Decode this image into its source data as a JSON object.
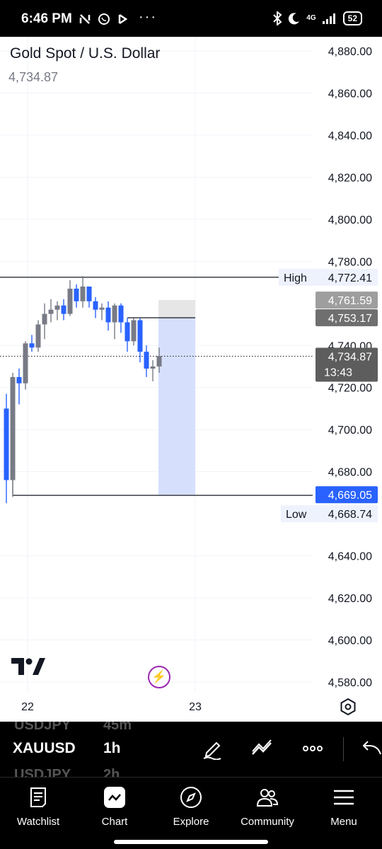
{
  "status_bar": {
    "time": "6:46 PM",
    "dots": "···",
    "network": "4G",
    "battery": "52"
  },
  "symbol": {
    "title": "Gold Spot / U.S. Dollar",
    "price": "4,734.87"
  },
  "chart_data": {
    "type": "candlestick",
    "title": "Gold Spot / U.S. Dollar",
    "ylim": [
      4574,
      4886
    ],
    "y_ticks": [
      4880,
      4860,
      4840,
      4820,
      4800,
      4780,
      4740,
      4720,
      4700,
      4680,
      4640,
      4620,
      4600,
      4580
    ],
    "y_tick_labels": [
      "4,880.00",
      "4,860.00",
      "4,840.00",
      "4,820.00",
      "4,800.00",
      "4,780.00",
      "4,740.00",
      "4,720.00",
      "4,700.00",
      "4,680.00",
      "4,640.00",
      "4,620.00",
      "4,600.00",
      "4,580.00"
    ],
    "x_tick_labels": [
      "22",
      "23"
    ],
    "up_color": "#787b86",
    "down_color": "#2962ff",
    "candles": [
      {
        "o": 4710,
        "h": 4717,
        "l": 4665,
        "c": 4676
      },
      {
        "o": 4676,
        "h": 4727,
        "l": 4668,
        "c": 4725
      },
      {
        "o": 4725,
        "h": 4729,
        "l": 4712,
        "c": 4722
      },
      {
        "o": 4722,
        "h": 4742,
        "l": 4719,
        "c": 4741
      },
      {
        "o": 4741,
        "h": 4745,
        "l": 4737,
        "c": 4739
      },
      {
        "o": 4739,
        "h": 4752,
        "l": 4737,
        "c": 4750
      },
      {
        "o": 4750,
        "h": 4760,
        "l": 4743,
        "c": 4755
      },
      {
        "o": 4755,
        "h": 4762,
        "l": 4751,
        "c": 4757
      },
      {
        "o": 4757,
        "h": 4761,
        "l": 4752,
        "c": 4759
      },
      {
        "o": 4759,
        "h": 4762,
        "l": 4752,
        "c": 4755
      },
      {
        "o": 4755,
        "h": 4771,
        "l": 4754,
        "c": 4767
      },
      {
        "o": 4767,
        "h": 4769,
        "l": 4758,
        "c": 4761
      },
      {
        "o": 4761,
        "h": 4773,
        "l": 4758,
        "c": 4768
      },
      {
        "o": 4768,
        "h": 4768,
        "l": 4758,
        "c": 4761
      },
      {
        "o": 4761,
        "h": 4763,
        "l": 4753,
        "c": 4757
      },
      {
        "o": 4757,
        "h": 4760,
        "l": 4752,
        "c": 4758
      },
      {
        "o": 4758,
        "h": 4761,
        "l": 4747,
        "c": 4751
      },
      {
        "o": 4751,
        "h": 4760,
        "l": 4743,
        "c": 4759
      },
      {
        "o": 4759,
        "h": 4760,
        "l": 4746,
        "c": 4751
      },
      {
        "o": 4751,
        "h": 4753,
        "l": 4737,
        "c": 4742
      },
      {
        "o": 4742,
        "h": 4753,
        "l": 4740,
        "c": 4752
      },
      {
        "o": 4752,
        "h": 4753,
        "l": 4732,
        "c": 4737
      },
      {
        "o": 4737,
        "h": 4740,
        "l": 4725,
        "c": 4729
      },
      {
        "o": 4729,
        "h": 4733,
        "l": 4723,
        "c": 4730
      },
      {
        "o": 4730,
        "h": 4739,
        "l": 4727,
        "c": 4735
      }
    ],
    "high_line": {
      "label": "High",
      "value_label": "4,772.41",
      "value": 4772.41
    },
    "low_line": {
      "label": "Low",
      "value_label": "4,668.74",
      "value": 4668.74
    },
    "level_4761": {
      "value_label": "4,761.59",
      "value": 4761.59
    },
    "level_4753": {
      "value_label": "4,753.17",
      "value": 4753.17
    },
    "level_4669": {
      "value_label": "4,669.05",
      "value": 4669.05
    },
    "current": {
      "value_label": "4,734.87",
      "countdown": "13:43",
      "value": 4734.87
    },
    "position_box": {
      "top": 4761.59,
      "entry": 4753.17,
      "bottom": 4669.05
    },
    "colors": {
      "grid": "#f0f3fa",
      "accent": "#2962ff",
      "position_fill": "#d6e0fd",
      "label_gray": "#787b86"
    }
  },
  "toolbar": {
    "symbol": "XAUUSD",
    "interval": "1h",
    "ghost_symbol_top": "USDJPY",
    "ghost_interval_top": "45m",
    "ghost_symbol_bottom": "USDJPY",
    "ghost_interval_bottom": "2h",
    "icons": [
      "draw-icon",
      "indicators-icon",
      "more-icon",
      "back-icon"
    ]
  },
  "bottom_nav": [
    {
      "label": "Watchlist",
      "icon": "watchlist-icon"
    },
    {
      "label": "Chart",
      "icon": "chart-icon"
    },
    {
      "label": "Explore",
      "icon": "compass-icon"
    },
    {
      "label": "Community",
      "icon": "community-icon"
    },
    {
      "label": "Menu",
      "icon": "menu-icon"
    }
  ]
}
